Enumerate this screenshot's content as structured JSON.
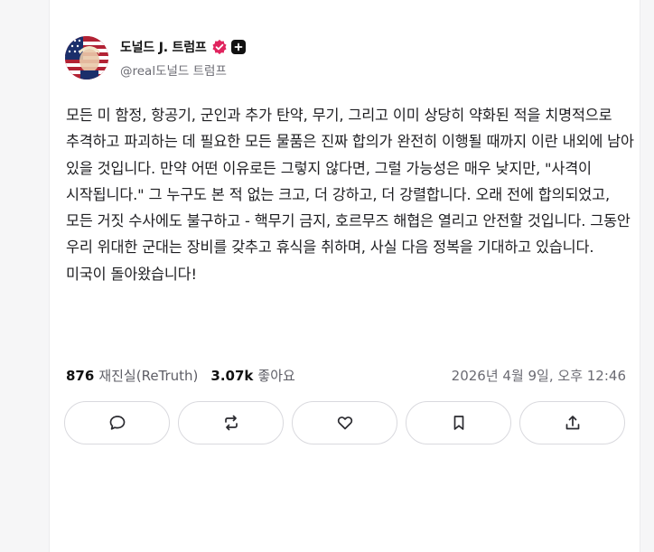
{
  "post": {
    "author": {
      "display_name": "도널드 J. 트럼프",
      "handle": "@real도널드 트럼프",
      "verified_icon": "verified-check-icon",
      "accent": "#e0245e"
    },
    "text": "모든 미 함정, 항공기, 군인과 추가 탄약, 무기, 그리고 이미 상당히 약화된 적을 치명적으로 추격하고 파괴하는 데 필요한 모든 물품은 진짜 합의가 완전히 이행될 때까지 이란 내외에 남아 있을 것입니다. 만약 어떤 이유로든 그렇지 않다면, 그럴 가능성은 매우 낮지만, \"사격이 시작됩니다.\" 그 누구도 본 적 없는 크고, 더 강하고, 더 강렬합니다. 오래 전에 합의되었고, 모든 거짓 수사에도 불구하고 - 핵무기 금지, 호르무즈 해협은 열리고 안전할 것입니다. 그동안 우리 위대한 군대는 장비를 갖추고 휴식을 취하며, 사실 다음 정복을 기대하고 있습니다. 미국이 돌아왔습니다!",
    "retruth_count": "876",
    "retruth_label": "재진실(ReTruth)",
    "like_count": "3.07k",
    "like_label": "좋아요",
    "timestamp": "2026년 4월 9일, 오후 12:46"
  },
  "actions": [
    {
      "icon": "comment-icon"
    },
    {
      "icon": "retruth-icon"
    },
    {
      "icon": "heart-icon"
    },
    {
      "icon": "bookmark-icon"
    },
    {
      "icon": "share-icon"
    }
  ]
}
